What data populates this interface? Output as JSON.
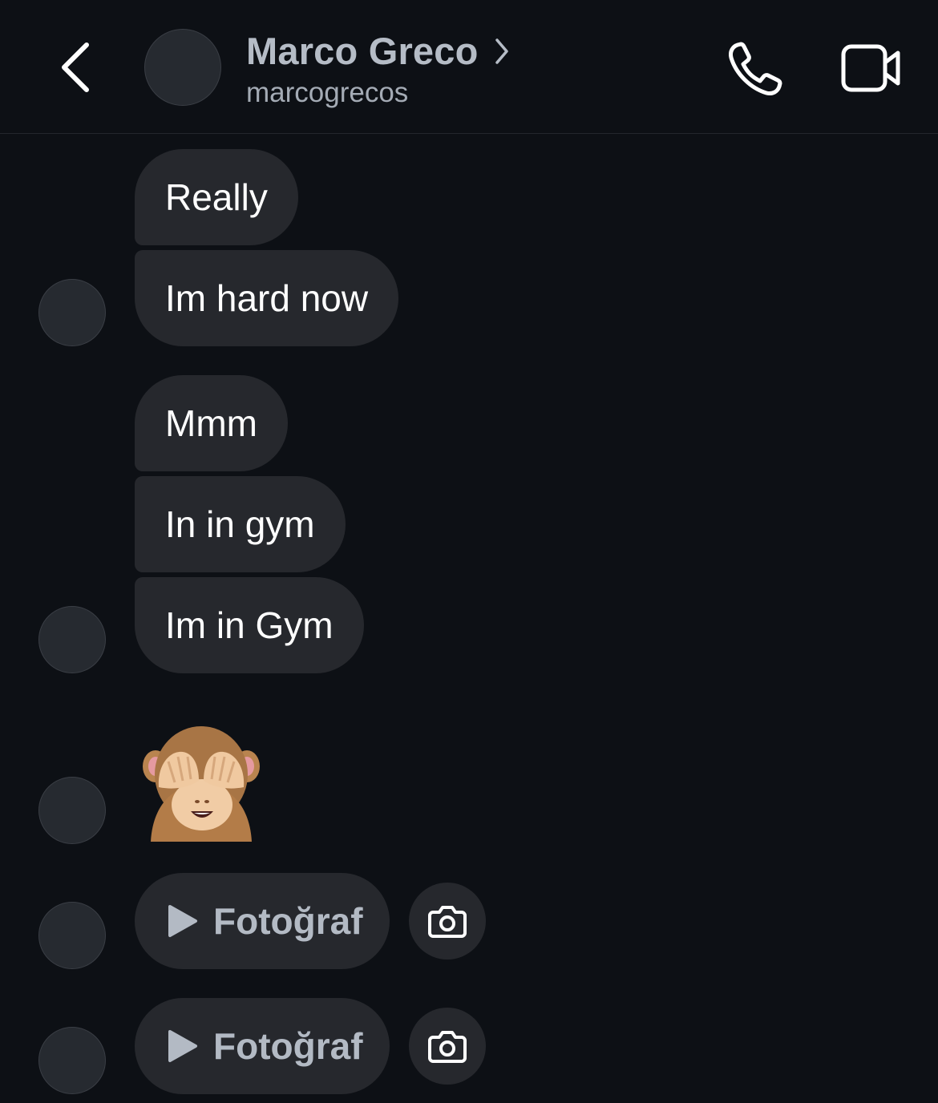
{
  "header": {
    "display_name": "Marco Greco",
    "username": "marcogrecos",
    "icons": {
      "back": "chevron-left-icon",
      "profile": "chevron-right-icon",
      "call": "phone-icon",
      "video": "video-camera-icon"
    }
  },
  "messages": [
    {
      "type": "text",
      "text": "Really"
    },
    {
      "type": "text",
      "text": "Im hard now"
    },
    {
      "type": "text",
      "text": "Mmm"
    },
    {
      "type": "text",
      "text": "In in gym"
    },
    {
      "type": "text",
      "text": "Im in Gym"
    },
    {
      "type": "emoji",
      "emoji": "see-no-evil-monkey"
    },
    {
      "type": "media",
      "label": "Fotoğraf",
      "icon": "play-icon",
      "action_icon": "camera-icon"
    },
    {
      "type": "media",
      "label": "Fotoğraf",
      "icon": "play-icon",
      "action_icon": "camera-icon"
    }
  ],
  "colors": {
    "background": "#0d1015",
    "bubble": "#26282d",
    "muted_text": "#b3bac4"
  }
}
